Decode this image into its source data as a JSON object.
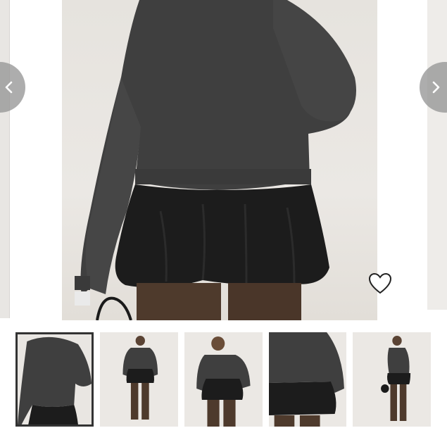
{
  "gallery": {
    "prev_icon": "chevron-left-icon",
    "next_icon": "chevron-right-icon",
    "favorite_icon": "heart-outline-icon",
    "selected_thumb_index": 0,
    "thumbnail_count": 5
  },
  "colors": {
    "sweater": "#3f3f3f",
    "skirt": "#1c1c1c",
    "pants": "#4e3a2c",
    "nav_button": "#969696",
    "selected_border": "#333333"
  }
}
